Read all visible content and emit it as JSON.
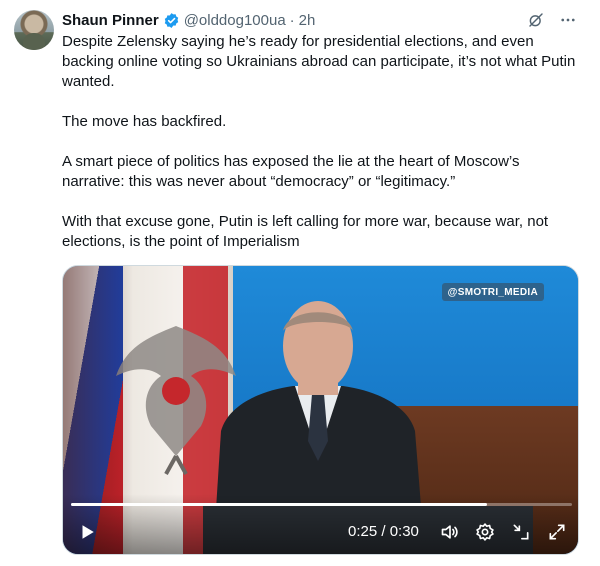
{
  "author": {
    "name": "Shaun Pinner",
    "handle": "@olddog100ua",
    "separator": "·",
    "time": "2h",
    "verified": true
  },
  "header_actions": [
    {
      "icon": "grok-icon"
    },
    {
      "icon": "more-icon"
    }
  ],
  "tweet": {
    "paragraphs": [
      "Despite Zelensky saying he’s ready for presidential elections, and even backing online voting so Ukrainians abroad can participate, it’s not what Putin wanted.",
      "The move has backfired.",
      "A smart piece of politics has exposed the lie at the heart of Moscow’s narrative: this was never about “democracy” or “legitimacy.”",
      "With that excuse gone, Putin is left calling for more war, because war, not elections, is the point of Imperialism"
    ]
  },
  "video": {
    "watermark": "@SMOTRI_MEDIA",
    "current_time": "0:25",
    "duration": "0:30",
    "time_display": "0:25 / 0:30",
    "progress_fraction": 0.83,
    "controls": [
      "play-icon",
      "volume-icon",
      "settings-icon",
      "minimize-icon",
      "fullscreen-icon"
    ]
  },
  "colors": {
    "verified_badge": "#1d9bf0",
    "text_primary": "#0f1419",
    "text_secondary": "#536471"
  }
}
